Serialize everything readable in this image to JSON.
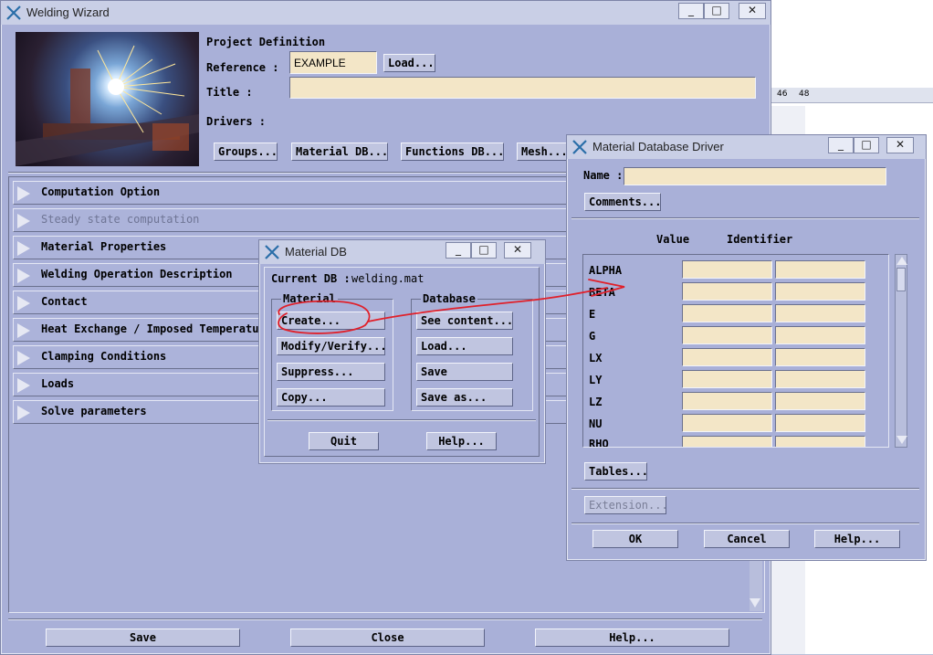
{
  "main": {
    "title": "Welding Wizard",
    "project_definition": "Project Definition",
    "reference_label": "Reference :",
    "reference_value": "EXAMPLE",
    "load_button": "Load...",
    "title_label": "Title :",
    "title_value": "",
    "drivers_label": "Drivers :",
    "drivers": [
      "Groups...",
      "Material DB...",
      "Functions DB...",
      "Mesh..."
    ],
    "sections": [
      {
        "label": "Computation Option",
        "enabled": true
      },
      {
        "label": "Steady state computation",
        "enabled": false
      },
      {
        "label": "Material Properties",
        "enabled": true
      },
      {
        "label": "Welding Operation Description",
        "enabled": true
      },
      {
        "label": "Contact",
        "enabled": true
      },
      {
        "label": "Heat Exchange / Imposed Temperatur",
        "enabled": true
      },
      {
        "label": "Clamping Conditions",
        "enabled": true
      },
      {
        "label": "Loads",
        "enabled": true
      },
      {
        "label": "Solve parameters",
        "enabled": true
      }
    ],
    "footer": [
      "Save",
      "Close",
      "Help..."
    ]
  },
  "background": {
    "ruler_ticks": [
      "46",
      "48"
    ]
  },
  "matdb": {
    "title": "Material DB",
    "current_db_label": "Current DB :",
    "current_db_value": "welding.mat",
    "material_group": "Material",
    "database_group": "Database",
    "material_buttons": [
      "Create...",
      "Modify/Verify...",
      "Suppress...",
      "Copy..."
    ],
    "database_buttons": [
      "See content...",
      "Load...",
      "Save",
      "Save as..."
    ],
    "quit_button": "Quit",
    "help_button": "Help..."
  },
  "driver": {
    "title": "Material Database Driver",
    "name_label": "Name :",
    "name_value": "",
    "comments_button": "Comments...",
    "col_value": "Value",
    "col_identifier": "Identifier",
    "properties": [
      "ALPHA",
      "BETA",
      "E",
      "G",
      "LX",
      "LY",
      "LZ",
      "NU",
      "RHO"
    ],
    "tables_button": "Tables...",
    "extension_button": "Extension...",
    "ok_button": "OK",
    "cancel_button": "Cancel",
    "help_button": "Help..."
  },
  "colors": {
    "window_bg": "#a9b0d8",
    "field_bg": "#f3e6c7",
    "annotation": "#e0202a"
  }
}
